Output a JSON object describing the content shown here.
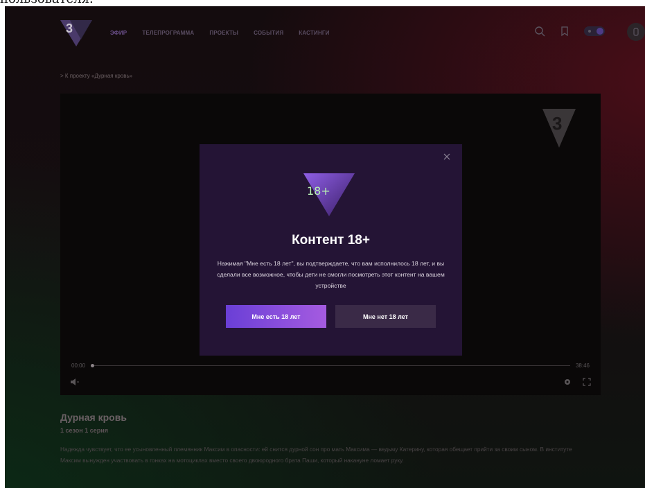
{
  "top_fragment": "пользователя.",
  "header": {
    "logo_char": "3",
    "nav": [
      "ЭФИР",
      "ТЕЛЕПРОГРАММА",
      "ПРОЕКТЫ",
      "СОБЫТИЯ",
      "КАСТИНГИ"
    ],
    "icons": [
      "search-icon",
      "bookmark-icon",
      "theme-toggle",
      "user-icon"
    ]
  },
  "breadcrumb": "> К проекту «Дурная кровь»",
  "player": {
    "time_current": "00:00",
    "time_total": "38:46",
    "progress": 0
  },
  "modal": {
    "badge": "18+",
    "title": "Контент 18+",
    "text": "Нажимая \"Мне есть 18 лет\", вы подтверждаете, что вам исполнилось 18 лет, и вы сделали все возможное, чтобы дети не смогли посмотреть этот контент на вашем устройстве",
    "yes_label": "Мне есть 18 лет",
    "no_label": "Мне нет 18 лет"
  },
  "episode": {
    "title": "Дурная кровь",
    "subtitle": "1 сезон 1 серия",
    "description": "Надежда чувствует, что ее усыновленный племянник Максим в опасности: ей снится дурной сон про мать Максима — ведьму Катерину, которая обещает прийти за своим сыном. В институте Максим вынужден участвовать в гонках на мотоциклах вместо своего двоюродного брата Паши, который накануне ломает руку."
  },
  "colors": {
    "accent": "#7a45d9",
    "modal_bg": "#241435",
    "badge_text": "#b7f1b3"
  }
}
